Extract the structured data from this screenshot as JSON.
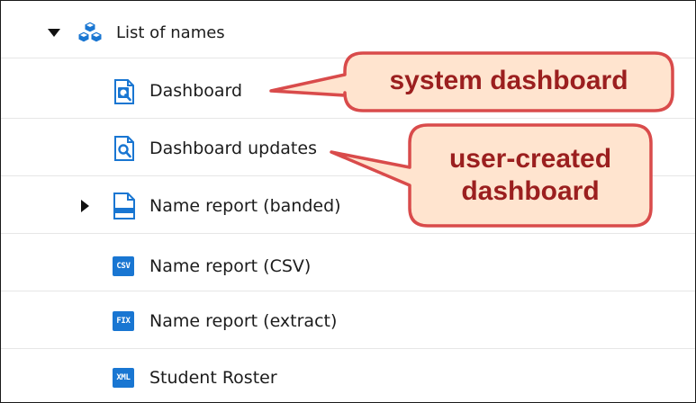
{
  "tree": {
    "root": {
      "label": "List of names",
      "icon": "dataset-cubes-icon",
      "expanded": true
    },
    "items": [
      {
        "label": "Dashboard",
        "icon": "dashboard-icon"
      },
      {
        "label": "Dashboard updates",
        "icon": "dashboard-icon"
      },
      {
        "label": "Name report (banded)",
        "icon": "banded-report-icon",
        "expandable": true,
        "expanded": false
      },
      {
        "label": "Name report (CSV)",
        "icon": "csv-file-icon",
        "badge": "CSV"
      },
      {
        "label": "Name report (extract)",
        "icon": "fix-file-icon",
        "badge": "FIX"
      },
      {
        "label": "Student Roster",
        "icon": "xml-file-icon",
        "badge": "XML"
      }
    ]
  },
  "callouts": {
    "system": {
      "text": "system dashboard"
    },
    "user": {
      "line1": "user-created",
      "line2": "dashboard"
    }
  },
  "colors": {
    "icon_blue": "#1976d2",
    "callout_fill": "#ffe4cf",
    "callout_border": "#d94b4b",
    "callout_text": "#9b1f1f"
  }
}
